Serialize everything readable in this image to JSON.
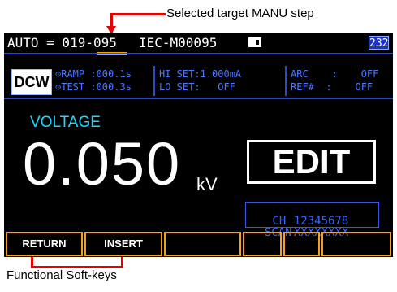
{
  "callouts": {
    "top": "Selected target MANU step",
    "bottom": "Functional Soft-keys"
  },
  "status_bar": {
    "auto_prefix": "AUTO = 019-",
    "step": "095",
    "standard": "IEC-M00095",
    "counter": "232"
  },
  "test": {
    "mode": "DCW",
    "ramp": "RAMP :000.1s",
    "test_time": "TEST :000.3s",
    "hi_set": "HI SET:1.000mA",
    "lo_set": "LO SET:   OFF",
    "arc": "ARC    :    OFF",
    "ref": "REF#  :    OFF"
  },
  "measurement": {
    "label": "VOLTAGE",
    "value": "0.050",
    "unit": "kV"
  },
  "edit_button": "EDIT",
  "channels": {
    "ch_label": "CH",
    "ch_numbers": "12345678",
    "scan_label": "SCAN",
    "scan_values": "XXXXXXXX"
  },
  "softkeys": [
    "RETURN",
    "INSERT",
    "",
    "",
    "",
    ""
  ],
  "colors": {
    "accent_blue": "#4f78ff",
    "voltage_cyan": "#1fd8ff",
    "softkey_border": "#f3a21c",
    "callout_red": "#e60000"
  }
}
